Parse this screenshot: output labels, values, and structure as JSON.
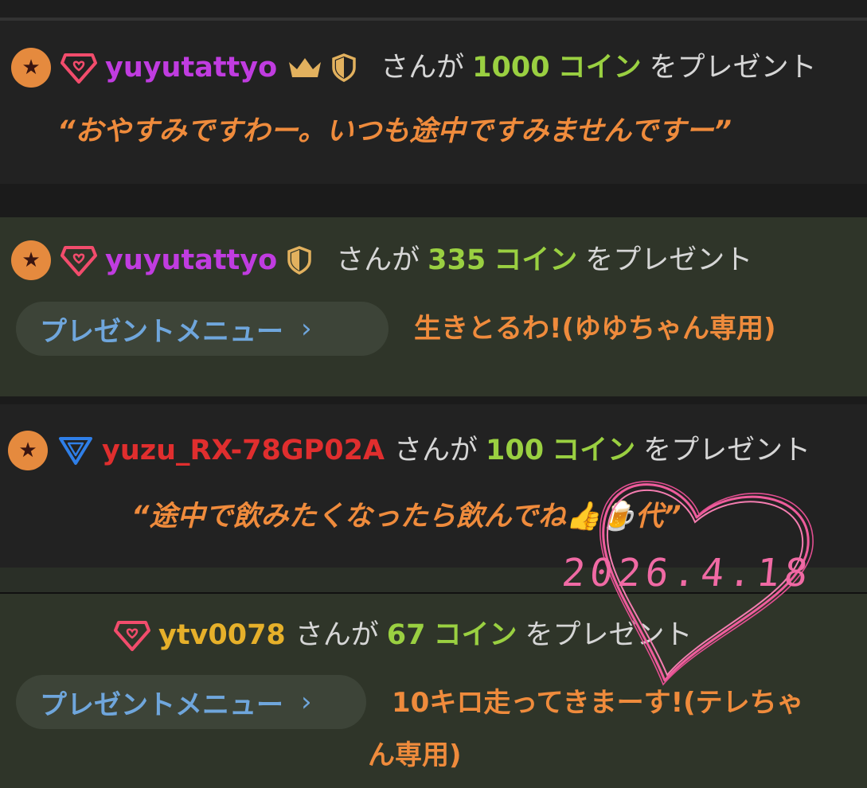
{
  "gifts": [
    {
      "username": "yuyutattyo",
      "user_color": "#c03ce0",
      "badges": [
        "star-badge",
        "heart-gem-badge",
        "crown-icon",
        "shield-icon"
      ],
      "text_before": "さんが",
      "amount": "1000",
      "unit": "コイン",
      "text_after": "をプレゼント",
      "message": "“おやすみですわー。いつも途中ですみませんですー”"
    },
    {
      "username": "yuyutattyo",
      "user_color": "#c03ce0",
      "badges": [
        "star-badge",
        "heart-gem-badge",
        "shield-icon"
      ],
      "text_before": "さんが",
      "amount": "335",
      "unit": "コイン",
      "text_after": "をプレゼント",
      "menu_label": "プレゼントメニュー",
      "menu_chevron": "›",
      "menu_item": "生きとるわ!(ゆゆちゃん専用)"
    },
    {
      "username": "yuzu_RX-78GP02A",
      "user_color": "#e02e2e",
      "badges": [
        "star-badge",
        "triangle-gem-badge"
      ],
      "text_before": "さんが",
      "amount": "100",
      "unit": "コイン",
      "text_after": "をプレゼント",
      "message": "“途中で飲みたくなったら飲んでね👍🍺代”"
    },
    {
      "username": "ytv0078",
      "user_color": "#e6b02a",
      "badges": [
        "heart-gem-badge"
      ],
      "text_before": "さんが",
      "amount": "67",
      "unit": "コイン",
      "text_after": "をプレゼント",
      "menu_label": "プレゼントメニュー",
      "menu_chevron": "›",
      "menu_item_line1": "10キロ走ってきまーす!(テレちゃ",
      "menu_item_line2": "ん専用)"
    }
  ],
  "stamp_date": "2026.4.18",
  "colors": {
    "dark_bg": "#222222",
    "olive_bg": "#2f3529",
    "coin_green": "#9ad041",
    "message_orange": "#ef8b3c",
    "menu_blue": "#6fa6dc",
    "stamp_pink": "#f06aa4"
  }
}
